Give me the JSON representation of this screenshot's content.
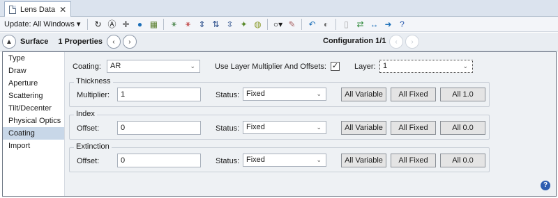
{
  "tab": {
    "title": "Lens Data",
    "close": "✕"
  },
  "toolbar": {
    "update_label": "Update: All Windows ▾",
    "icons": [
      "refresh-icon",
      "auto-refresh-icon",
      "crosshair-icon",
      "globe-icon",
      "chart-icon",
      "split-icon",
      "merge-icon",
      "move-icon",
      "flip-icon",
      "tilt-icon",
      "lens-icon",
      "palette-icon",
      "circle-icon",
      "brush-icon",
      "loop-icon",
      "toggle-icon",
      "doc-icon",
      "arrows-icon",
      "swap-icon",
      "right-arrow-icon",
      "help-icon"
    ]
  },
  "header": {
    "surface_label": "Surface",
    "properties_label": "1 Properties",
    "config_label": "Configuration 1/1"
  },
  "sidebar": {
    "items": [
      "Type",
      "Draw",
      "Aperture",
      "Scattering",
      "Tilt/Decenter",
      "Physical Optics",
      "Coating",
      "Import"
    ],
    "active": "Coating"
  },
  "coating": {
    "label": "Coating:",
    "value": "AR",
    "layer_mult_label": "Use Layer Multiplier And Offsets:",
    "layer_mult_checked": "✓",
    "layer_label": "Layer:",
    "layer_value": "1"
  },
  "thickness": {
    "title": "Thickness",
    "field_label": "Multiplier:",
    "field_value": "1",
    "status_label": "Status:",
    "status_value": "Fixed",
    "btn1": "All Variable",
    "btn2": "All Fixed",
    "btn3": "All 1.0"
  },
  "index": {
    "title": "Index",
    "field_label": "Offset:",
    "field_value": "0",
    "status_label": "Status:",
    "status_value": "Fixed",
    "btn1": "All Variable",
    "btn2": "All Fixed",
    "btn3": "All 0.0"
  },
  "extinction": {
    "title": "Extinction",
    "field_label": "Offset:",
    "field_value": "0",
    "status_label": "Status:",
    "status_value": "Fixed",
    "btn1": "All Variable",
    "btn2": "All Fixed",
    "btn3": "All 0.0"
  }
}
